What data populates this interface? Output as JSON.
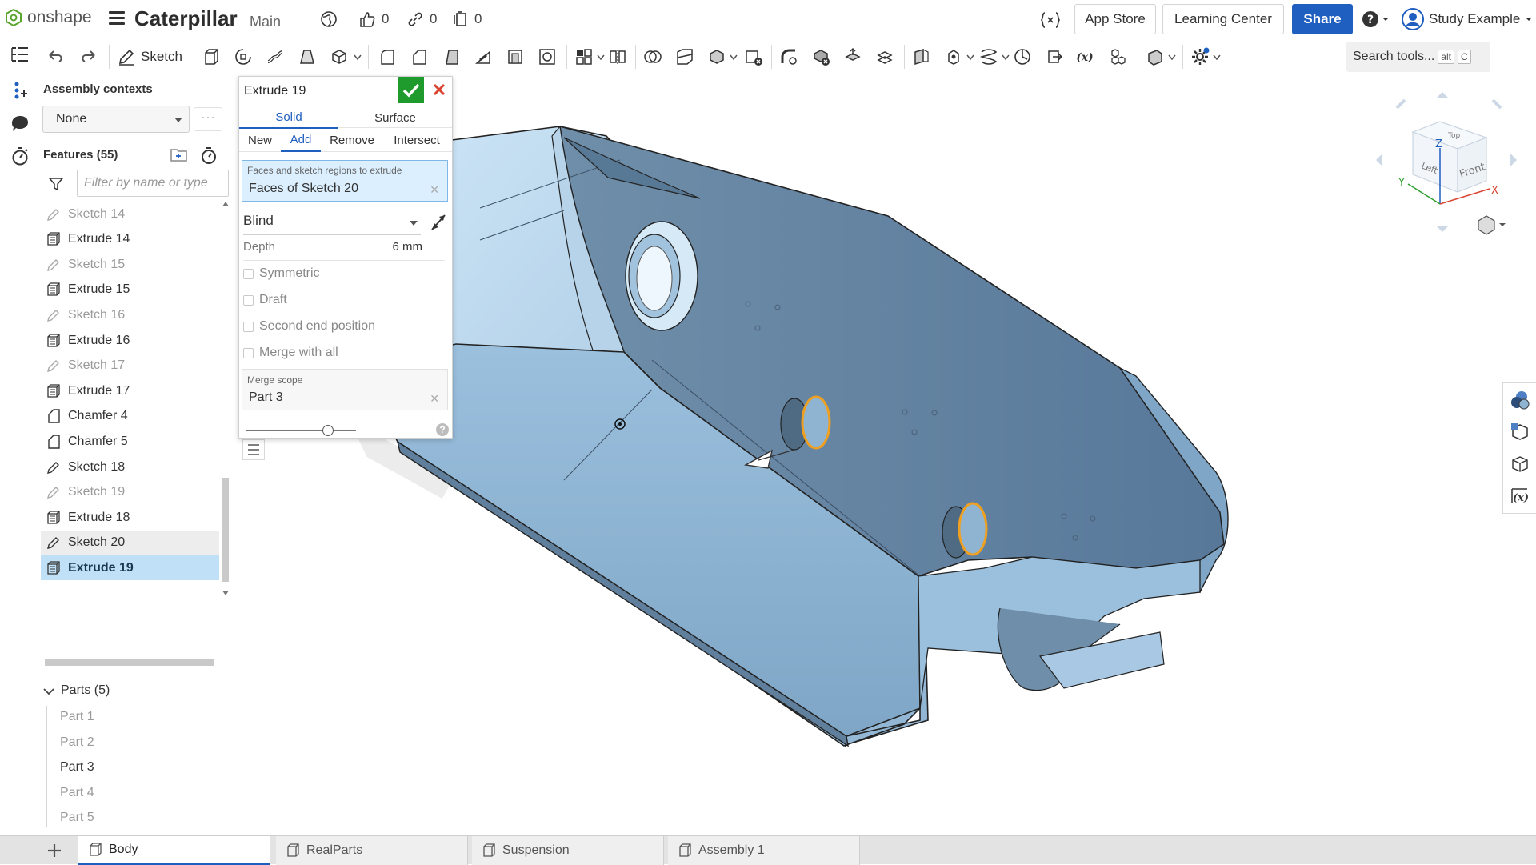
{
  "app": {
    "logo_text": "onshape",
    "doc_title": "Caterpillar",
    "branch": "Main",
    "likes": "0",
    "links": "0",
    "copies": "0",
    "app_store": "App Store",
    "learning_center": "Learning Center",
    "share": "Share",
    "user": "Study Example",
    "brand_color": "#1f5fbf"
  },
  "toolbar": {
    "sketch_label": "Sketch",
    "search_placeholder": "Search tools...",
    "search_key1": "alt",
    "search_key2": "C"
  },
  "panel": {
    "assembly_contexts": "Assembly contexts",
    "context_value": "None",
    "features_title": "Features (55)",
    "filter_placeholder": "Filter by name or type",
    "features": [
      {
        "label": "Sketch 14",
        "type": "sketch",
        "state": "dim"
      },
      {
        "label": "Extrude 14",
        "type": "extrude",
        "state": "normal"
      },
      {
        "label": "Sketch 15",
        "type": "sketch",
        "state": "dim"
      },
      {
        "label": "Extrude 15",
        "type": "extrude",
        "state": "normal"
      },
      {
        "label": "Sketch 16",
        "type": "sketch",
        "state": "dim"
      },
      {
        "label": "Extrude 16",
        "type": "extrude",
        "state": "normal"
      },
      {
        "label": "Sketch 17",
        "type": "sketch",
        "state": "dim"
      },
      {
        "label": "Extrude 17",
        "type": "extrude",
        "state": "normal"
      },
      {
        "label": "Chamfer 4",
        "type": "chamfer",
        "state": "normal"
      },
      {
        "label": "Chamfer 5",
        "type": "chamfer",
        "state": "normal"
      },
      {
        "label": "Sketch 18",
        "type": "sketch",
        "state": "normal"
      },
      {
        "label": "Sketch 19",
        "type": "sketch",
        "state": "dim"
      },
      {
        "label": "Extrude 18",
        "type": "extrude",
        "state": "normal"
      },
      {
        "label": "Sketch 20",
        "type": "sketch",
        "state": "highlight"
      },
      {
        "label": "Extrude 19",
        "type": "extrude",
        "state": "selected"
      }
    ],
    "parts_title": "Parts (5)",
    "parts": [
      {
        "label": "Part 1",
        "active": false
      },
      {
        "label": "Part 2",
        "active": false
      },
      {
        "label": "Part 3",
        "active": true
      },
      {
        "label": "Part 4",
        "active": false
      },
      {
        "label": "Part 5",
        "active": false
      }
    ]
  },
  "dialog": {
    "title": "Extrude 19",
    "tabs": [
      "Solid",
      "Surface"
    ],
    "active_tab": "Solid",
    "operations": [
      "New",
      "Add",
      "Remove",
      "Intersect"
    ],
    "active_operation": "Add",
    "selection_label": "Faces and sketch regions to extrude",
    "selection_value": "Faces of Sketch 20",
    "end_type": "Blind",
    "depth_label": "Depth",
    "depth_value": "6 mm",
    "options": [
      "Symmetric",
      "Draft",
      "Second end position",
      "Merge with all"
    ],
    "merge_scope_label": "Merge scope",
    "merge_scope_value": "Part 3",
    "help": "?"
  },
  "viewcube": {
    "faces": [
      "Top",
      "Left",
      "Front"
    ],
    "axes": [
      "Z",
      "Y",
      "X"
    ]
  },
  "bottom_tabs": [
    {
      "label": "Body",
      "active": true
    },
    {
      "label": "RealParts",
      "active": false
    },
    {
      "label": "Suspension",
      "active": false
    },
    {
      "label": "Assembly 1",
      "active": false
    }
  ],
  "colors": {
    "model_fill": "#a9c8e3",
    "model_dark": "#5f7f9c",
    "selection_orange": "#f0a020",
    "ok_green": "#1f9b2e",
    "cancel_red": "#d9432f",
    "selected_row": "#bfe0f7"
  }
}
